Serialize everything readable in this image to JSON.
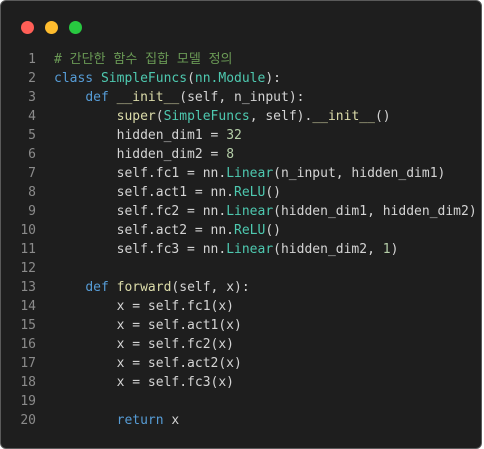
{
  "window": {
    "controls": [
      {
        "name": "close",
        "color": "#ff5f57"
      },
      {
        "name": "minimize",
        "color": "#febc2e"
      },
      {
        "name": "maximize",
        "color": "#28c840"
      }
    ]
  },
  "colors": {
    "background": "#1e1e1e",
    "default": "#d4d4d4",
    "keyword": "#569cd6",
    "class": "#4ec9b0",
    "function": "#dcdcaa",
    "builtin": "#dcdcaa",
    "number": "#b5cea8",
    "comment": "#6a9955",
    "line_number": "#8b8b8b"
  },
  "code": {
    "lines": [
      {
        "num": "1",
        "tokens": [
          [
            "comment",
            "# 간단한 함수 집합 모델 정의"
          ]
        ]
      },
      {
        "num": "2",
        "tokens": [
          [
            "keyword",
            "class"
          ],
          [
            "default",
            " "
          ],
          [
            "class",
            "SimpleFuncs"
          ],
          [
            "default",
            "("
          ],
          [
            "class",
            "nn.Module"
          ],
          [
            "default",
            "):"
          ]
        ]
      },
      {
        "num": "3",
        "tokens": [
          [
            "default",
            "    "
          ],
          [
            "keyword",
            "def"
          ],
          [
            "default",
            " "
          ],
          [
            "function",
            "__init__"
          ],
          [
            "default",
            "(self, n_input):"
          ]
        ]
      },
      {
        "num": "4",
        "tokens": [
          [
            "default",
            "        "
          ],
          [
            "function",
            "super"
          ],
          [
            "default",
            "("
          ],
          [
            "class",
            "SimpleFuncs"
          ],
          [
            "default",
            ", self)."
          ],
          [
            "function",
            "__init__"
          ],
          [
            "default",
            "()"
          ]
        ]
      },
      {
        "num": "5",
        "tokens": [
          [
            "default",
            "        hidden_dim1 = "
          ],
          [
            "number",
            "32"
          ]
        ]
      },
      {
        "num": "6",
        "tokens": [
          [
            "default",
            "        hidden_dim2 = "
          ],
          [
            "number",
            "8"
          ]
        ]
      },
      {
        "num": "7",
        "tokens": [
          [
            "default",
            "        self.fc1 = nn."
          ],
          [
            "class",
            "Linear"
          ],
          [
            "default",
            "(n_input, hidden_dim1)"
          ]
        ]
      },
      {
        "num": "8",
        "tokens": [
          [
            "default",
            "        self.act1 = nn."
          ],
          [
            "class",
            "ReLU"
          ],
          [
            "default",
            "()"
          ]
        ]
      },
      {
        "num": "9",
        "tokens": [
          [
            "default",
            "        self.fc2 = nn."
          ],
          [
            "class",
            "Linear"
          ],
          [
            "default",
            "(hidden_dim1, hidden_dim2)"
          ]
        ]
      },
      {
        "num": "10",
        "tokens": [
          [
            "default",
            "        self.act2 = nn."
          ],
          [
            "class",
            "ReLU"
          ],
          [
            "default",
            "()"
          ]
        ]
      },
      {
        "num": "11",
        "tokens": [
          [
            "default",
            "        self.fc3 = nn."
          ],
          [
            "class",
            "Linear"
          ],
          [
            "default",
            "(hidden_dim2, "
          ],
          [
            "number",
            "1"
          ],
          [
            "default",
            ")"
          ]
        ]
      },
      {
        "num": "12",
        "tokens": []
      },
      {
        "num": "13",
        "tokens": [
          [
            "default",
            "    "
          ],
          [
            "keyword",
            "def"
          ],
          [
            "default",
            " "
          ],
          [
            "function",
            "forward"
          ],
          [
            "default",
            "(self, x):"
          ]
        ]
      },
      {
        "num": "14",
        "tokens": [
          [
            "default",
            "        x = self.fc1(x)"
          ]
        ]
      },
      {
        "num": "15",
        "tokens": [
          [
            "default",
            "        x = self.act1(x)"
          ]
        ]
      },
      {
        "num": "16",
        "tokens": [
          [
            "default",
            "        x = self.fc2(x)"
          ]
        ]
      },
      {
        "num": "17",
        "tokens": [
          [
            "default",
            "        x = self.act2(x)"
          ]
        ]
      },
      {
        "num": "18",
        "tokens": [
          [
            "default",
            "        x = self.fc3(x)"
          ]
        ]
      },
      {
        "num": "19",
        "tokens": []
      },
      {
        "num": "20",
        "tokens": [
          [
            "default",
            "        "
          ],
          [
            "keyword",
            "return"
          ],
          [
            "default",
            " x"
          ]
        ]
      }
    ]
  }
}
